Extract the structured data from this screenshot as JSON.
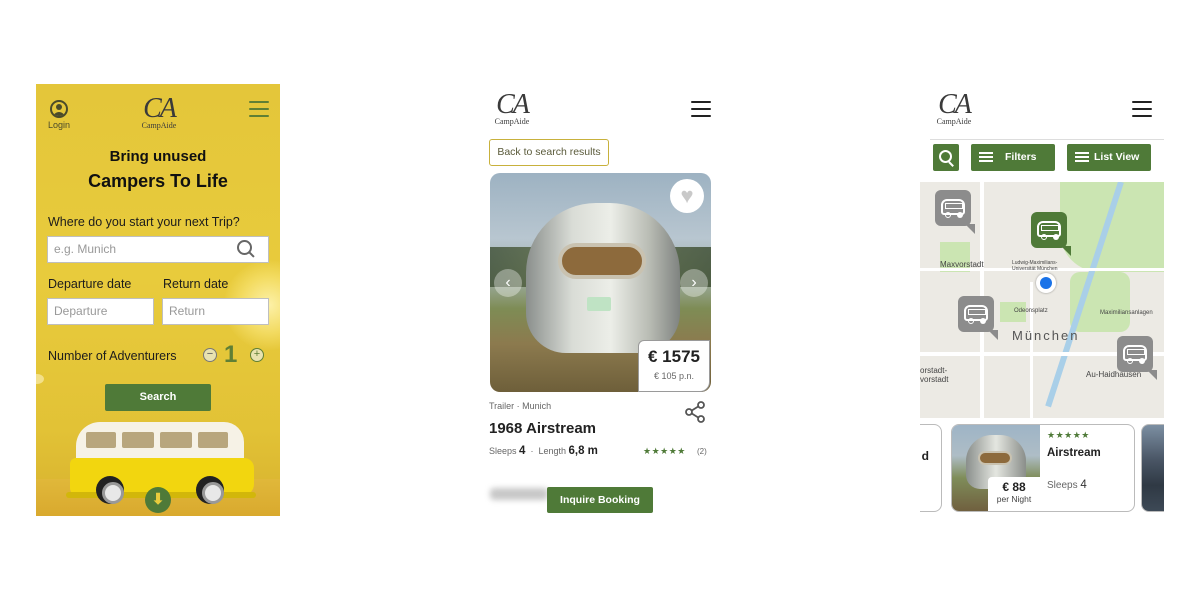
{
  "screen1": {
    "login_label": "Login",
    "logo": {
      "mark": "CA",
      "name": "CampAide"
    },
    "headline_line1": "Bring unused",
    "headline_line2": "Campers To Life",
    "trip_question": "Where do you start your next Trip?",
    "search_placeholder": "e.g. Munich",
    "departure_label": "Departure date",
    "departure_placeholder": "Departure",
    "return_label": "Return date",
    "return_placeholder": "Return",
    "adventurers_label": "Number of Adventurers",
    "adventurers_count": "1",
    "minus_label": "−",
    "plus_label": "+",
    "search_button": "Search",
    "scroll_down_label": "⬇",
    "colors": {
      "background": "#e4c63a",
      "accent": "#4f7a38"
    }
  },
  "screen2": {
    "logo": {
      "mark": "CA",
      "name": "CampAide"
    },
    "back_button": "Back to search results",
    "heart_icon": "♥",
    "prev_arrow": "‹",
    "next_arrow": "›",
    "price_total": "€ 1575",
    "price_per_night": "€ 105 p.n.",
    "meta": "Trailer · Munich",
    "title": "1968 Airstream",
    "sleeps_label": "Sleeps",
    "sleeps_value": "4",
    "length_label": "Length",
    "length_value": "6,8 m",
    "stars": "★★★★★",
    "reviews": "(2)",
    "inquire_button": "Inquire Booking"
  },
  "screen3": {
    "logo": {
      "mark": "CA",
      "name": "CampAide"
    },
    "filters_button": "Filters",
    "list_view_button": "List View",
    "map_labels": {
      "city": "München",
      "maxvorstadt": "Maxvorstadt",
      "university": "Ludwig-Maximilians-Universität München",
      "isarvorstadt": "orstadt-vorstadt",
      "haidhausen": "Au-Haidhausen",
      "odeonsplatz": "Odeonsplatz",
      "maximiliansanlagen": "Maximiliansanlagen"
    },
    "left_card_fragment": "d",
    "card": {
      "price": "€ 88",
      "per_night": "per Night",
      "stars": "★★★★★",
      "name": "Airstream",
      "sleeps_label": "Sleeps",
      "sleeps_value": "4"
    }
  }
}
